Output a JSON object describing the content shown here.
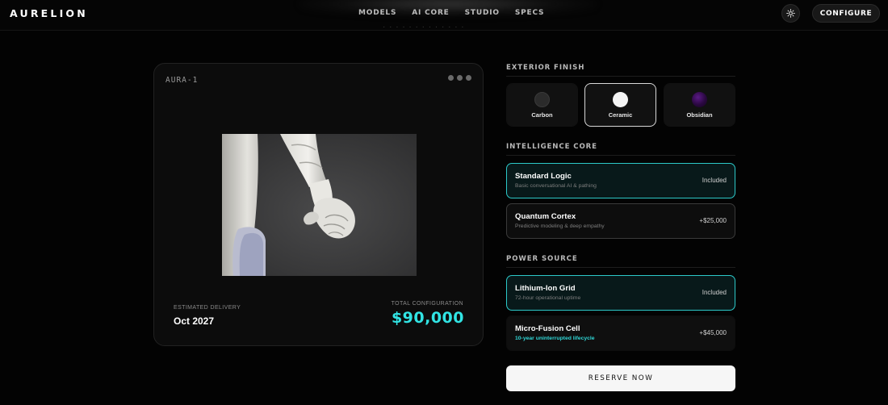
{
  "brand": {
    "logo": "AURELION"
  },
  "nav": {
    "items": [
      "MODELS",
      "AI CORE",
      "STUDIO",
      "SPECS"
    ]
  },
  "header": {
    "theme_icon": "sun-icon",
    "configure_label": "CONFIGURE"
  },
  "preview": {
    "model_label": "AURA-1",
    "menu_icon": "more-dots-icon",
    "delivery_label": "ESTIMATED DELIVERY",
    "delivery_value": "Oct 2027",
    "total_label": "TOTAL CONFIGURATION",
    "total_value": "$90,000"
  },
  "exterior": {
    "title": "EXTERIOR FINISH",
    "options": [
      {
        "label": "Carbon",
        "color": "#2b2b2b",
        "selected": false
      },
      {
        "label": "Ceramic",
        "color": "#f4f4f4",
        "selected": true
      },
      {
        "label": "Obsidian",
        "color": "#3a0d55",
        "selected": false
      }
    ]
  },
  "intelligence": {
    "title": "INTELLIGENCE CORE",
    "options": [
      {
        "name": "Standard Logic",
        "desc": "Basic conversational AI & pathing",
        "price": "Included",
        "selected": true
      },
      {
        "name": "Quantum Cortex",
        "desc": "Predictive modeling & deep empathy",
        "price": "+$25,000",
        "selected": false
      }
    ]
  },
  "power": {
    "title": "POWER SOURCE",
    "options": [
      {
        "name": "Lithium-Ion Grid",
        "desc": "72-hour operational uptime",
        "price": "Included",
        "selected": true
      },
      {
        "name": "Micro-Fusion Cell",
        "desc": "10-year uninterrupted lifecycle",
        "price": "+$45,000",
        "selected": false
      }
    ]
  },
  "actions": {
    "reserve_label": "RESERVE NOW"
  },
  "colors": {
    "accent": "#31e4e4",
    "background": "#030303",
    "card": "#0c0c0c"
  }
}
